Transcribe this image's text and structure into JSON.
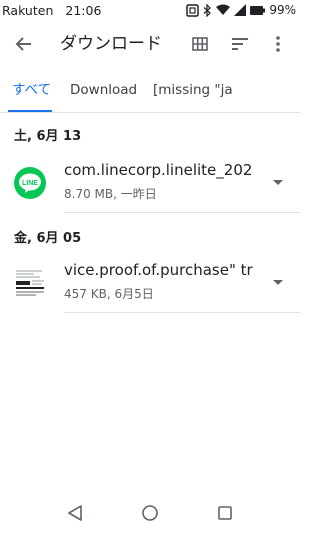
{
  "status_bar": {
    "carrier": "Rakuten",
    "time": "21:06",
    "battery": "99%"
  },
  "app_bar": {
    "title": "ダウンロード",
    "icons": [
      "back-arrow-icon",
      "grid-view-icon",
      "sort-icon",
      "more-vert-icon"
    ]
  },
  "tabs": [
    {
      "label": "すべて",
      "selected": true
    },
    {
      "label": "Download",
      "selected": false
    },
    {
      "label": "[missing \"ja",
      "selected": false
    }
  ],
  "sections": [
    {
      "header": "土, 6月 13",
      "items": [
        {
          "name": "com.linecorp.linelite_202",
          "meta": "8.70 MB, 一昨日",
          "thumb_text": "LINE",
          "thumb_color": "#06c755"
        }
      ]
    },
    {
      "header": "金, 6月 05",
      "items": [
        {
          "name": "vice.proof.of.purchase\" tr",
          "meta": "457 KB, 6月5日"
        }
      ]
    }
  ],
  "colors": {
    "accent": "#1a73e8",
    "line_green": "#06c755"
  }
}
